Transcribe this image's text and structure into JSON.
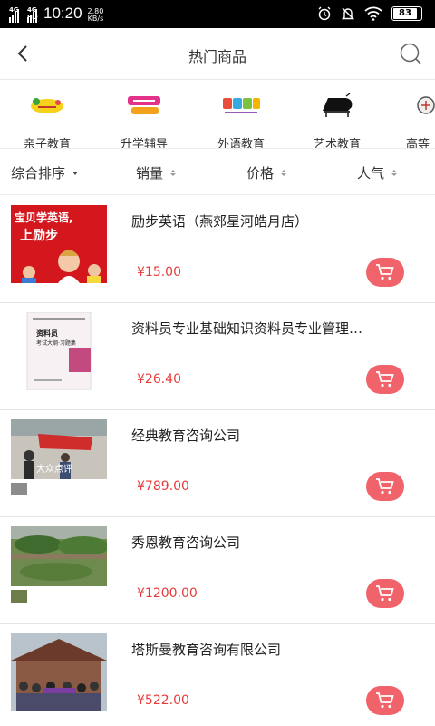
{
  "status_bar": {
    "time": "10:20",
    "net1": "4G",
    "net2": "4G HD",
    "speed_value": "2.80",
    "speed_unit": "KB/s",
    "battery": "83"
  },
  "nav": {
    "title": "热门商品",
    "back_icon": "chevron-left-icon",
    "search_icon": "search-icon"
  },
  "categories": [
    {
      "label": "亲子教育",
      "icon": "parent-child-logo"
    },
    {
      "label": "升学辅导",
      "icon": "tutoring-logo"
    },
    {
      "label": "外语教育",
      "icon": "foreign-language-logo"
    },
    {
      "label": "艺术教育",
      "icon": "piano-icon"
    },
    {
      "label": "高等",
      "icon": "higher-education-icon"
    }
  ],
  "sort_bar": {
    "items": [
      {
        "label": "综合排序"
      },
      {
        "label": "销量"
      },
      {
        "label": "价格"
      },
      {
        "label": "人气"
      }
    ]
  },
  "products": [
    {
      "title": "励步英语（燕郊星河皓月店）",
      "price": "¥15.00",
      "thumb_text_1": "宝贝学英语,",
      "thumb_text_2": "上励步"
    },
    {
      "title": "资料员专业基础知识资料员专业管理…",
      "price": "¥26.40",
      "thumb_text_1": "资料员",
      "thumb_text_2": "考试大纲·习题集"
    },
    {
      "title": "经典教育咨询公司",
      "price": "¥789.00",
      "thumb_text_1": "大众点评"
    },
    {
      "title": "秀恩教育咨询公司",
      "price": "¥1200.00"
    },
    {
      "title": "塔斯曼教育咨询有限公司",
      "price": "¥522.00"
    }
  ],
  "colors": {
    "accent": "#f0636a",
    "price": "#e73a3a"
  }
}
